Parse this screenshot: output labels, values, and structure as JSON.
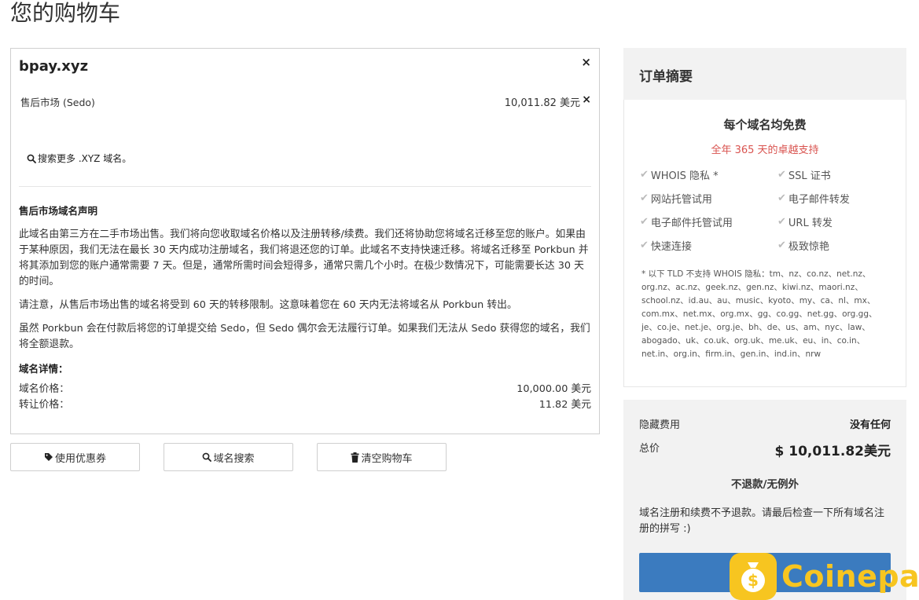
{
  "page_title": "您的购物车",
  "cart": {
    "domain": "bpay.xyz",
    "close_icon": "×",
    "market_label": "售后市场 (Sedo)",
    "market_price": "10,011.82 美元",
    "row_remove_icon": "×",
    "search_more": "搜索更多 .XYZ 域名。",
    "notice_title": "售后市场域名声明",
    "notice_p1": "此域名由第三方在二手市场出售。我们将向您收取域名价格以及注册转移/续费。我们还将协助您将域名迁移至您的账户。如果由于某种原因，我们无法在最长 30 天内成功注册域名，我们将退还您的订单。此域名不支持快速迁移。将域名迁移至 Porkbun 并将其添加到您的账户通常需要 7 天。但是，通常所需时间会短得多，通常只需几个小时。在极少数情况下，可能需要长达 30 天的时间。",
    "notice_p2": "请注意，从售后市场出售的域名将受到 60 天的转移限制。这意味着您在 60 天内无法将域名从 Porkbun 转出。",
    "notice_p3": "虽然 Porkbun 会在付款后将您的订单提交给 Sedo，但 Sedo 偶尔会无法履行订单。如果我们无法从 Sedo 获得您的域名，我们将全额退款。",
    "details_title": "域名详情：",
    "domain_price_label": "域名价格：",
    "domain_price": "10,000.00 美元",
    "transfer_price_label": "转让价格：",
    "transfer_price": "11.82 美元"
  },
  "buttons": {
    "coupon": "使用优惠券",
    "domain_search": "域名搜索",
    "empty_cart": "清空购物车"
  },
  "summary": {
    "title": "订单摘要",
    "free_title": "每个域名均免费",
    "support_line": "全年 365 天的卓越支持",
    "features": [
      "WHOIS 隐私 *",
      "SSL 证书",
      "网站托管试用",
      "电子邮件转发",
      "电子邮件托管试用",
      "URL 转发",
      "快速连接",
      "极致惊艳"
    ],
    "tld_note": "* 以下 TLD 不支持 WHOIS 隐私：tm、nz、co.nz、net.nz、org.nz、ac.nz、geek.nz、gen.nz、kiwi.nz、maori.nz、school.nz、id.au、au、music、kyoto、my、ca、nl、mx、com.mx、net.mx、org.mx、gg、co.gg、net.gg、org.gg、je、co.je、net.je、org.je、bh、de、us、am、nyc、law、abogado、uk、co.uk、org.uk、me.uk、eu、in、co.in、net.in、org.in、firm.in、gen.in、ind.in、nrw",
    "hidden_fee_label": "隐藏费用",
    "hidden_fee_value": "没有任何",
    "total_label": "总价",
    "total_value": "$ 10,011.82美元",
    "no_refund": "不退款/无例外",
    "refund_note": "域名注册和续费不予退款。请最后检查一下所有域名注册的拼写 :)",
    "checkout_label": "结算"
  },
  "watermark": {
    "text": "Coinepay",
    "logo_glyph": "$"
  },
  "icons": {
    "search": "search-icon",
    "tag": "tag-icon",
    "trash": "trash-icon",
    "check": "check-icon"
  }
}
